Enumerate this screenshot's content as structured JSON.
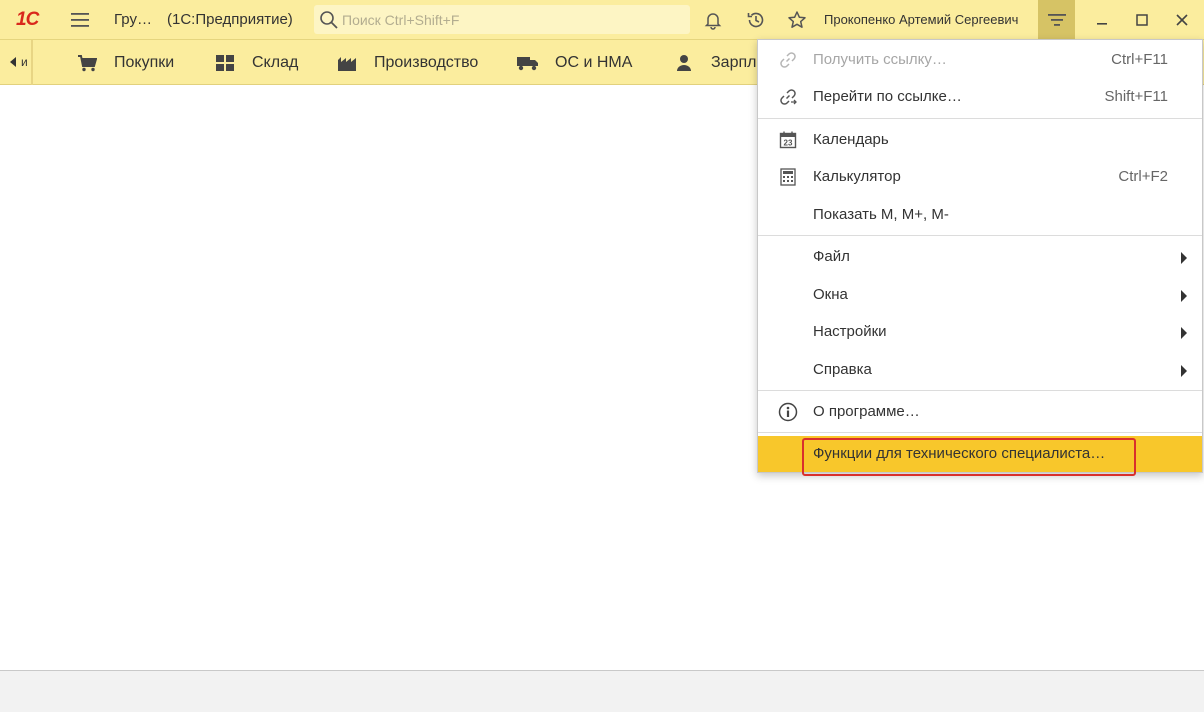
{
  "titlebar": {
    "logo": "1С",
    "app_title": "Гру…",
    "app_subtitle": "(1С:Предприятие)",
    "search_placeholder": "Поиск Ctrl+Shift+F",
    "user_name": "Прокопенко Артемий Сергеевич"
  },
  "sections": {
    "cut_label": "и",
    "items": [
      {
        "label": "Покупки",
        "icon": "cart-icon"
      },
      {
        "label": "Склад",
        "icon": "warehouse-icon"
      },
      {
        "label": "Производство",
        "icon": "factory-icon"
      },
      {
        "label": "ОС и НМА",
        "icon": "truck-icon"
      },
      {
        "label": "Зарпл",
        "icon": "person-icon"
      }
    ]
  },
  "menu": {
    "get_link": {
      "label": "Получить ссылку…",
      "shortcut": "Ctrl+F11",
      "icon": "link-icon",
      "disabled": true
    },
    "go_link": {
      "label": "Перейти по ссылке…",
      "shortcut": "Shift+F11",
      "icon": "go-link-icon"
    },
    "calendar": {
      "label": "Календарь",
      "icon": "calendar-icon",
      "calendar_day": "23"
    },
    "calculator": {
      "label": "Калькулятор",
      "shortcut": "Ctrl+F2",
      "icon": "calculator-icon"
    },
    "show_m": {
      "label": "Показать M, M+, M-"
    },
    "file": {
      "label": "Файл"
    },
    "windows": {
      "label": "Окна"
    },
    "settings": {
      "label": "Настройки"
    },
    "help": {
      "label": "Справка"
    },
    "about": {
      "label": "О программе…",
      "icon": "info-icon"
    },
    "tech": {
      "label": "Функции для технического специалиста…"
    }
  },
  "colors": {
    "panel": "#fbed9e",
    "accent": "#f8c72b",
    "highlight_border": "#d9302c",
    "logo": "#d9281c"
  }
}
